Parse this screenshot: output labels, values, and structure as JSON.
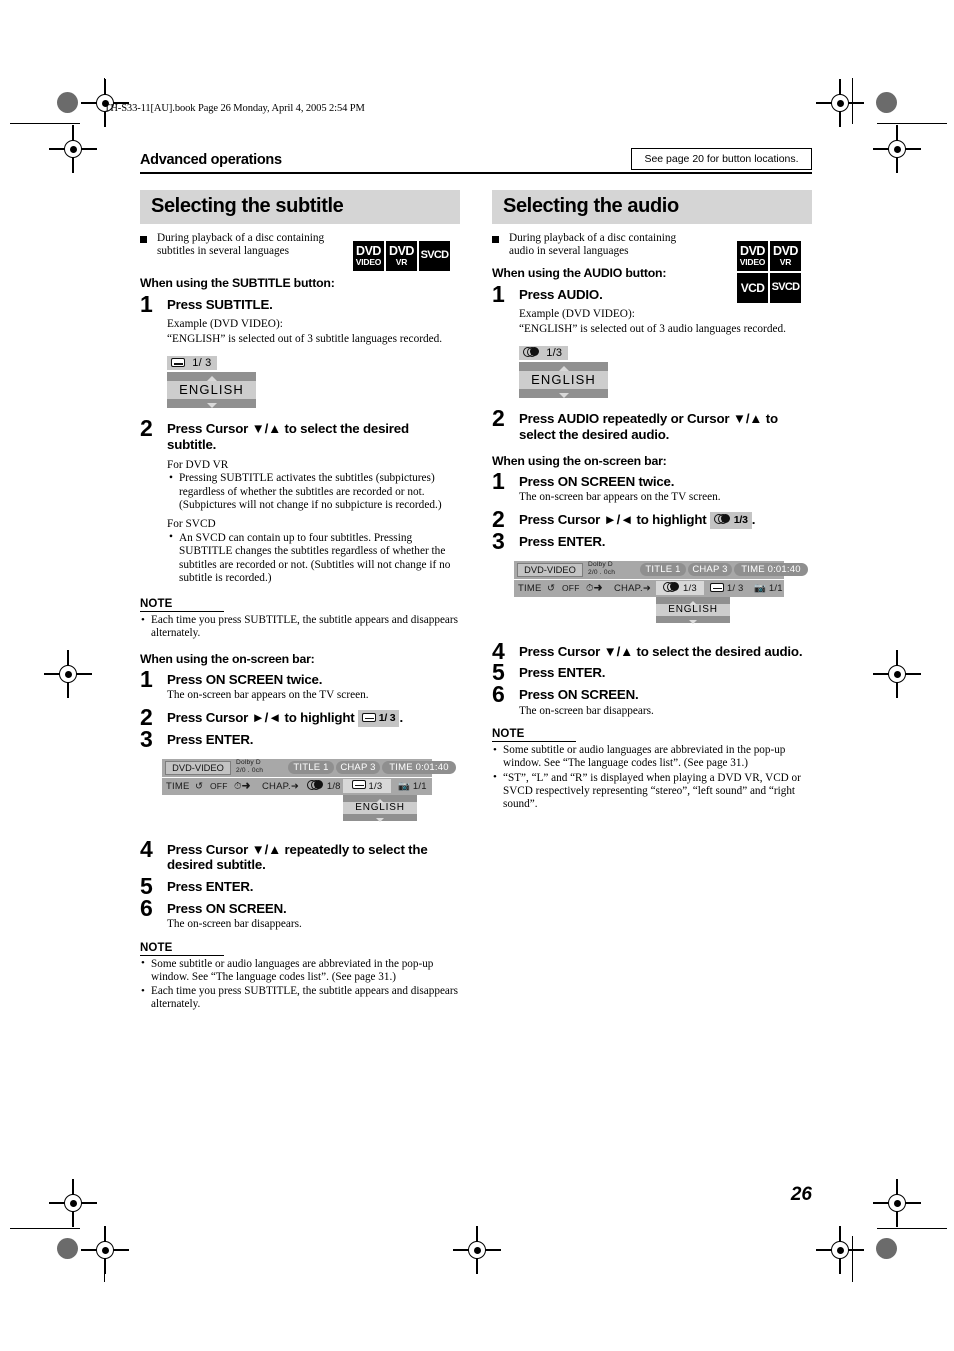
{
  "header": {
    "file_line": "TH-S33-11[AU].book  Page 26  Monday, April 4, 2005  2:54 PM",
    "section": "Advanced operations",
    "see_page_note": "See page 20 for button locations."
  },
  "page_number": "26",
  "left_column": {
    "title": "Selecting the subtitle",
    "lead_in": "During playback of a disc containing subtitles in several languages",
    "badges": [
      "DVD VIDEO",
      "DVD VR",
      "SVCD"
    ],
    "badge_rows": [
      [
        {
          "top": "DVD",
          "bottom": "VIDEO"
        },
        {
          "top": "DVD",
          "bottom": "VR"
        },
        {
          "top": "SVCD",
          "bottom": ""
        }
      ]
    ],
    "sub_head_button": "When using the SUBTITLE button:",
    "step1": {
      "num": "1",
      "text": "Press SUBTITLE.",
      "example_label": "Example (DVD VIDEO):",
      "example_text": "“ENGLISH” is selected out of 3 subtitle languages recorded.",
      "osd": {
        "icon": "subtitle-icon",
        "counter": "1/ 3",
        "language": "ENGLISH"
      }
    },
    "step2": {
      "num": "2",
      "text": "Press Cursor ▼/▲ to select the desired subtitle.",
      "dvdvr_head": "For DVD VR",
      "dvdvr_bullet": "Pressing SUBTITLE activates the subtitles (subpictures) regardless of whether the subtitles are recorded or not. (Subpictures will not change if no subpicture is recorded.)",
      "svcd_head": "For SVCD",
      "svcd_bullet": "An SVCD can contain up to four subtitles. Pressing SUBTITLE changes the subtitles regardless of whether the subtitles are recorded or not. (Subtitles will not change if no subtitle is recorded.)"
    },
    "note1": {
      "heading": "NOTE",
      "items": [
        "Each time you press SUBTITLE, the subtitle appears and disappears alternately."
      ]
    },
    "sub_head_bar": "When using the on-screen bar:",
    "bar_step1": {
      "num": "1",
      "text": "Press ON SCREEN twice.",
      "sub": "The on-screen bar appears on the TV screen."
    },
    "bar_step2": {
      "num": "2",
      "text_before": "Press Cursor ►/◄ to highlight",
      "chip": "1/ 3",
      "chip_icon": "subtitle-icon",
      "text_after": "."
    },
    "bar_step3": {
      "num": "3",
      "text": "Press ENTER."
    },
    "osbar": {
      "disc_label": "DVD-VIDEO",
      "audio_format": "Dolby D",
      "audio_format2": "2/0 . 0ch",
      "title_pill": "TITLE  1",
      "chap_pill": "CHAP  3",
      "time_pill": "TIME    0:01:40",
      "play_icon": "play-icon",
      "row2": {
        "time_label": "TIME",
        "repeat_icon": "repeat-icon",
        "repeat_value": "OFF",
        "clock_icon": "clock-arrow-icon",
        "chap_label": "CHAP.",
        "chap_arrow_icon": "arrow-right-icon",
        "audio_icon": "audio-icon",
        "audio_value": "1/8",
        "subtitle_icon": "subtitle-icon",
        "subtitle_value": "1/3",
        "angle_icon": "camera-angle-icon",
        "angle_value": "1/1"
      },
      "popup_language": "ENGLISH",
      "highlighted_field": "subtitle"
    },
    "bar_step4": {
      "num": "4",
      "text": "Press Cursor ▼/▲ repeatedly to select the desired subtitle."
    },
    "bar_step5": {
      "num": "5",
      "text": "Press ENTER."
    },
    "bar_step6": {
      "num": "6",
      "text": "Press ON SCREEN.",
      "sub": "The on-screen bar disappears."
    },
    "note2": {
      "heading": "NOTE",
      "items": [
        "Some subtitle or audio languages are abbreviated in the pop-up window. See “The language codes list”. (See page 31.)",
        "Each time you press SUBTITLE, the subtitle appears and disappears alternately."
      ]
    }
  },
  "right_column": {
    "title": "Selecting the audio",
    "lead_in": "During playback of a disc containing audio in several languages",
    "badges": [
      "DVD VIDEO",
      "DVD VR",
      "VCD",
      "SVCD"
    ],
    "badge_rows": [
      [
        {
          "top": "DVD",
          "bottom": "VIDEO"
        },
        {
          "top": "DVD",
          "bottom": "VR"
        }
      ],
      [
        {
          "top": "VCD",
          "bottom": ""
        },
        {
          "top": "SVCD",
          "bottom": ""
        }
      ]
    ],
    "sub_head_button": "When using the AUDIO button:",
    "step1": {
      "num": "1",
      "text": "Press AUDIO.",
      "example_label": "Example (DVD VIDEO):",
      "example_text": "“ENGLISH” is selected out of 3 audio languages recorded.",
      "osd": {
        "icon": "audio-icon",
        "counter": "1/3",
        "language": "ENGLISH"
      }
    },
    "step2": {
      "num": "2",
      "text": "Press AUDIO repeatedly or Cursor ▼/▲ to select the desired audio."
    },
    "sub_head_bar": "When using the on-screen bar:",
    "bar_step1": {
      "num": "1",
      "text": "Press ON SCREEN twice.",
      "sub": "The on-screen bar appears on the TV screen."
    },
    "bar_step2": {
      "num": "2",
      "text_before": "Press Cursor ►/◄ to highlight",
      "chip": "1/3",
      "chip_icon": "audio-icon",
      "text_after": "."
    },
    "bar_step3": {
      "num": "3",
      "text": "Press ENTER."
    },
    "osbar": {
      "disc_label": "DVD-VIDEO",
      "audio_format": "Dolby D",
      "audio_format2": "2/0 . 0ch",
      "title_pill": "TITLE  1",
      "chap_pill": "CHAP  3",
      "time_pill": "TIME    0:01:40",
      "play_icon": "play-icon",
      "row2": {
        "time_label": "TIME",
        "repeat_icon": "repeat-icon",
        "repeat_value": "OFF",
        "clock_icon": "clock-arrow-icon",
        "chap_label": "CHAP.",
        "chap_arrow_icon": "arrow-right-icon",
        "audio_icon": "audio-icon",
        "audio_value": "1/3",
        "subtitle_icon": "subtitle-icon",
        "subtitle_value": "1/ 3",
        "angle_icon": "camera-angle-icon",
        "angle_value": "1/1"
      },
      "popup_language": "ENGLISH",
      "highlighted_field": "audio"
    },
    "bar_step4": {
      "num": "4",
      "text": "Press Cursor ▼/▲ to select the desired audio."
    },
    "bar_step5": {
      "num": "5",
      "text": "Press ENTER."
    },
    "bar_step6": {
      "num": "6",
      "text": "Press ON SCREEN.",
      "sub": "The on-screen bar disappears."
    },
    "note": {
      "heading": "NOTE",
      "items": [
        "Some subtitle or audio languages are abbreviated in the pop-up window. See “The language codes list”. (See page 31.)",
        "“ST”, “L” and “R” is displayed when playing a DVD VR, VCD or SVCD respectively representing “stereo”, “left sound” and “right sound”."
      ]
    }
  },
  "colors": {
    "chapter_band": "#d5d5d5",
    "osd_window": "#909090",
    "osd_language": "#cdcdcd",
    "bar_background": "#a8a8a8",
    "badge_background": "#000000"
  }
}
